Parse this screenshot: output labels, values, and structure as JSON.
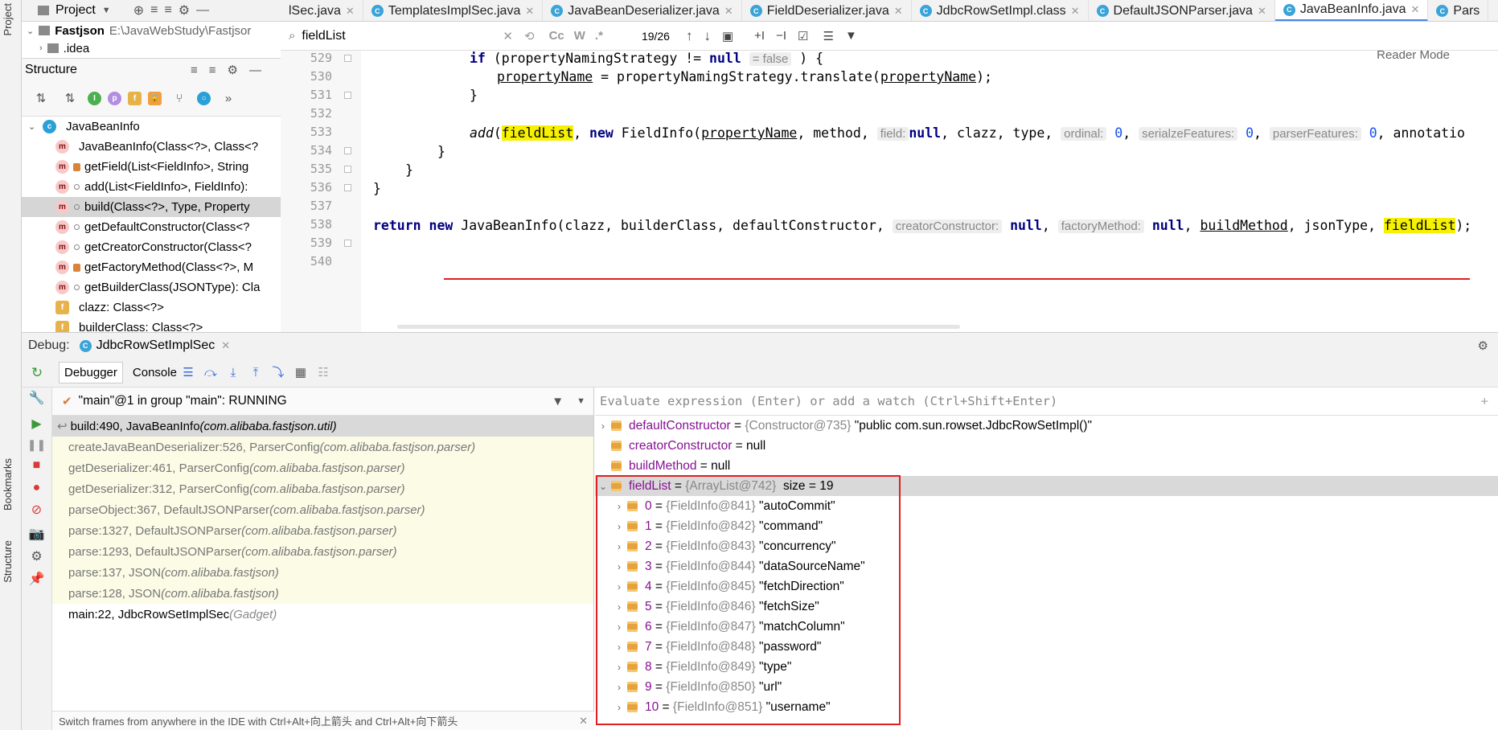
{
  "left_strip": {
    "project_label": "Project",
    "bookmarks_label": "Bookmarks",
    "structure_label": "Structure"
  },
  "project_panel": {
    "title": "Project",
    "root_name": "Fastjson",
    "root_path": "E:\\JavaWebStudy\\Fastjsor",
    "child": ".idea"
  },
  "structure_panel": {
    "title": "Structure",
    "items": [
      {
        "icon": "c",
        "label": "JavaBeanInfo"
      },
      {
        "icon": "m",
        "label": "JavaBeanInfo(Class<?>, Class<?"
      },
      {
        "icon": "m",
        "lock": true,
        "label": "getField(List<FieldInfo>, String"
      },
      {
        "icon": "m",
        "dot": true,
        "label": "add(List<FieldInfo>, FieldInfo):"
      },
      {
        "icon": "m",
        "dot": true,
        "label": "build(Class<?>, Type, Property"
      },
      {
        "icon": "m",
        "dot": true,
        "label": "getDefaultConstructor(Class<?"
      },
      {
        "icon": "m",
        "dot": true,
        "label": "getCreatorConstructor(Class<?"
      },
      {
        "icon": "m",
        "lock": true,
        "label": "getFactoryMethod(Class<?>, M"
      },
      {
        "icon": "m",
        "dot": true,
        "label": "getBuilderClass(JSONType): Cla"
      },
      {
        "icon": "f",
        "label": "clazz: Class<?>"
      },
      {
        "icon": "f",
        "label": "builderClass: Class<?>"
      }
    ]
  },
  "tabs": [
    {
      "label": "lSec.java"
    },
    {
      "label": "TemplatesImplSec.java"
    },
    {
      "label": "JavaBeanDeserializer.java"
    },
    {
      "label": "FieldDeserializer.java"
    },
    {
      "label": "JdbcRowSetImpl.class"
    },
    {
      "label": "DefaultJSONParser.java"
    },
    {
      "label": "JavaBeanInfo.java"
    },
    {
      "label": "Pars"
    }
  ],
  "search": {
    "query": "fieldList",
    "match_count": "19/26",
    "cc": "Cc",
    "w": "W",
    "regex": ".*"
  },
  "editor": {
    "reader_mode": "Reader Mode",
    "line_numbers": [
      "529",
      "530",
      "531",
      "532",
      "533",
      "534",
      "535",
      "536",
      "537",
      "538",
      "539",
      "540"
    ],
    "l529": {
      "kw_if": "if",
      "a": " (propertyNamingStrategy != ",
      "kw_null": "null",
      "hint": "= false",
      "b": " ) {"
    },
    "l530": {
      "a": "propertyName",
      "b": " = propertyNamingStrategy.translate(",
      "c": "propertyName",
      "d": ");"
    },
    "l531": "}",
    "l533": {
      "add": "add",
      "open": "(",
      "fl": "fieldList",
      "b": ", ",
      "kw_new": "new",
      "c": " FieldInfo(",
      "pn": "propertyName",
      "d": ", method, ",
      "h_field": "field:",
      "kw_null": "null",
      "e": ", clazz, type, ",
      "h_ord": "ordinal:",
      "n0a": "0",
      "f": ", ",
      "h_ser": "serialzeFeatures:",
      "n0b": "0",
      "g": ", ",
      "h_par": "parserFeatures:",
      "n0c": "0",
      "h": ", annotatio"
    },
    "l534": "}",
    "l535": "}",
    "l536": "}",
    "l538": {
      "kw_return": "return",
      "kw_new": "new",
      "a": " JavaBeanInfo(clazz, builderClass, defaultConstructor, ",
      "h_cc": "creatorConstructor:",
      "kw_null1": "null",
      "b": ", ",
      "h_fm": "factoryMethod:",
      "kw_null2": "null",
      "c": ", ",
      "bm": "buildMethod",
      "d": ", jsonType, ",
      "fl": "fieldList",
      "e": ");"
    }
  },
  "debug": {
    "label": "Debug:",
    "session": "JdbcRowSetImplSec",
    "tab_debugger": "Debugger",
    "tab_console": "Console",
    "thread": "\"main\"@1 in group \"main\": RUNNING",
    "eval_placeholder": "Evaluate expression (Enter) or add a watch (Ctrl+Shift+Enter)",
    "status_msg": "Switch frames from anywhere in the IDE with Ctrl+Alt+向上箭头 and Ctrl+Alt+向下箭头",
    "frames": [
      {
        "method": "build:490, JavaBeanInfo ",
        "pkg": "(com.alibaba.fastjson.util)"
      },
      {
        "method": "createJavaBeanDeserializer:526, ParserConfig ",
        "pkg": "(com.alibaba.fastjson.parser)"
      },
      {
        "method": "getDeserializer:461, ParserConfig ",
        "pkg": "(com.alibaba.fastjson.parser)"
      },
      {
        "method": "getDeserializer:312, ParserConfig ",
        "pkg": "(com.alibaba.fastjson.parser)"
      },
      {
        "method": "parseObject:367, DefaultJSONParser ",
        "pkg": "(com.alibaba.fastjson.parser)"
      },
      {
        "method": "parse:1327, DefaultJSONParser ",
        "pkg": "(com.alibaba.fastjson.parser)"
      },
      {
        "method": "parse:1293, DefaultJSONParser ",
        "pkg": "(com.alibaba.fastjson.parser)"
      },
      {
        "method": "parse:137, JSON ",
        "pkg": "(com.alibaba.fastjson)"
      },
      {
        "method": "parse:128, JSON ",
        "pkg": "(com.alibaba.fastjson)"
      },
      {
        "method": "main:22, JdbcRowSetImplSec ",
        "pkg": "(Gadget)"
      }
    ],
    "variables": {
      "defaultConstructor": {
        "name": "defaultConstructor",
        "ref": "{Constructor@735}",
        "value": "\"public com.sun.rowset.JdbcRowSetImpl()\""
      },
      "creatorConstructor": {
        "name": "creatorConstructor",
        "value": "null"
      },
      "buildMethod": {
        "name": "buildMethod",
        "value": "null"
      },
      "fieldList": {
        "name": "fieldList",
        "ref": "{ArrayList@742}",
        "size": "size = 19"
      },
      "items": [
        {
          "idx": "0",
          "ref": "{FieldInfo@841}",
          "value": "\"autoCommit\""
        },
        {
          "idx": "1",
          "ref": "{FieldInfo@842}",
          "value": "\"command\""
        },
        {
          "idx": "2",
          "ref": "{FieldInfo@843}",
          "value": "\"concurrency\""
        },
        {
          "idx": "3",
          "ref": "{FieldInfo@844}",
          "value": "\"dataSourceName\""
        },
        {
          "idx": "4",
          "ref": "{FieldInfo@845}",
          "value": "\"fetchDirection\""
        },
        {
          "idx": "5",
          "ref": "{FieldInfo@846}",
          "value": "\"fetchSize\""
        },
        {
          "idx": "6",
          "ref": "{FieldInfo@847}",
          "value": "\"matchColumn\""
        },
        {
          "idx": "7",
          "ref": "{FieldInfo@848}",
          "value": "\"password\""
        },
        {
          "idx": "8",
          "ref": "{FieldInfo@849}",
          "value": "\"type\""
        },
        {
          "idx": "9",
          "ref": "{FieldInfo@850}",
          "value": "\"url\""
        },
        {
          "idx": "10",
          "ref": "{FieldInfo@851}",
          "value": "\"username\""
        }
      ]
    }
  },
  "colors": {
    "highlight": "#f6f100",
    "annotation_red": "#e02020",
    "selection": "#d9d9d9",
    "keyword": "#000080"
  }
}
